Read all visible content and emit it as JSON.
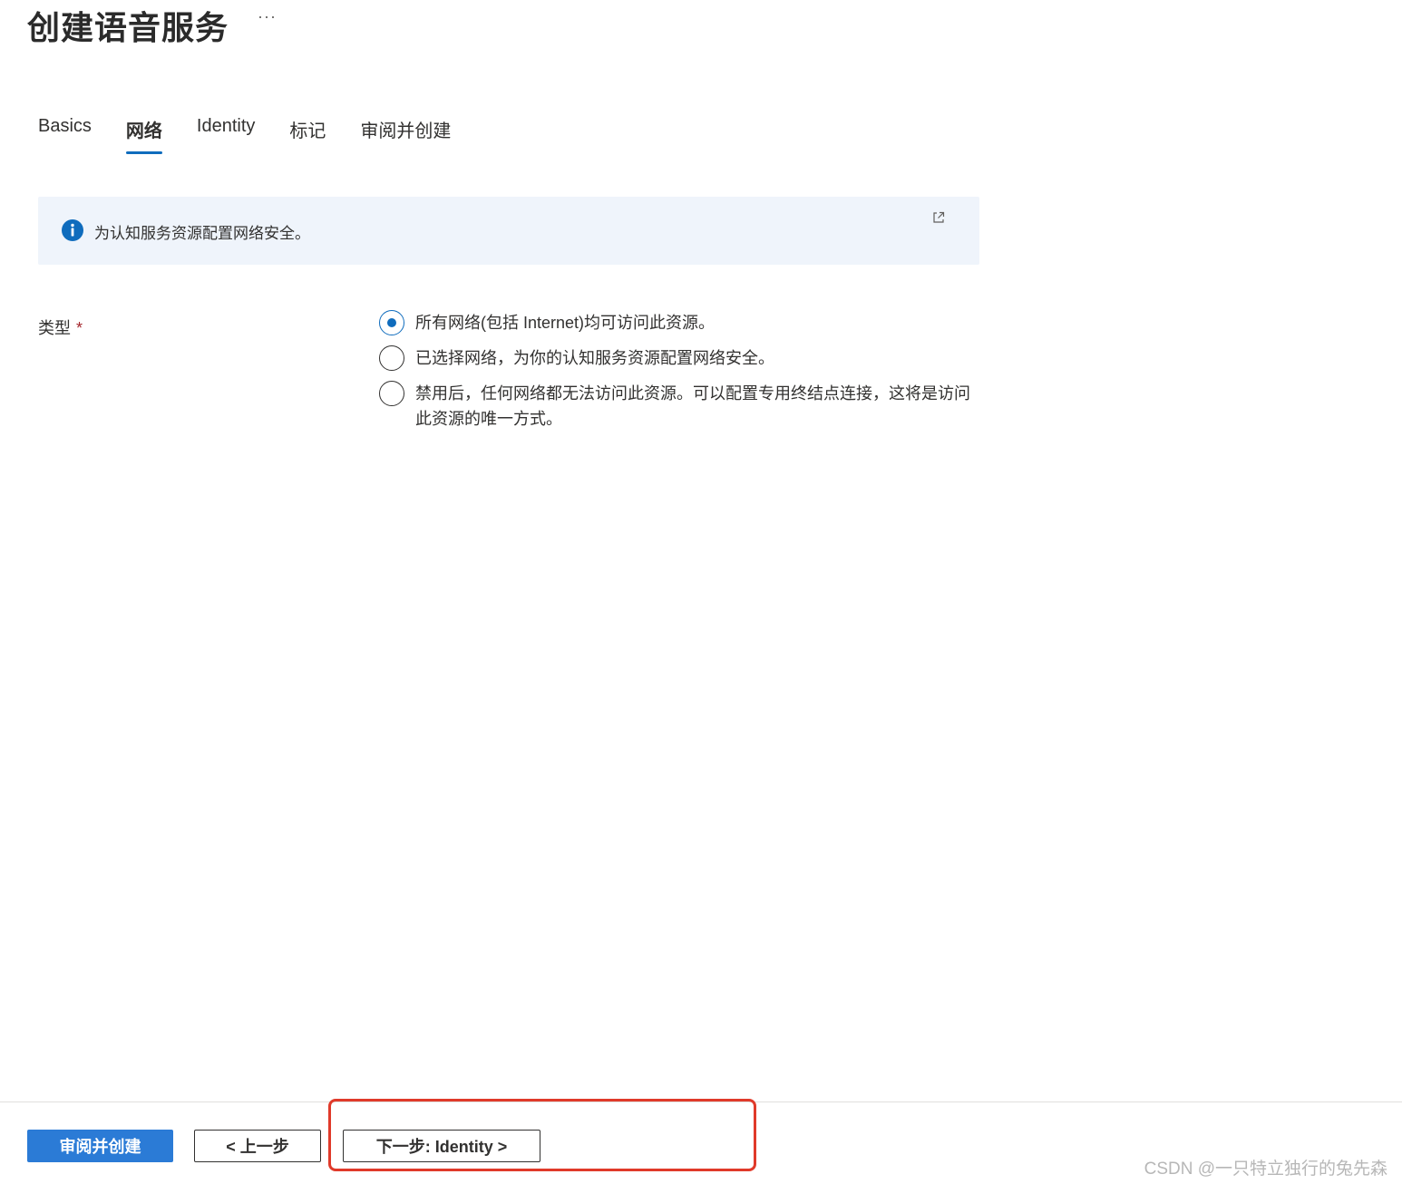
{
  "header": {
    "title": "创建语音服务",
    "more": "···"
  },
  "tabs": [
    {
      "label": "Basics",
      "active": false
    },
    {
      "label": "网络",
      "active": true
    },
    {
      "label": "Identity",
      "active": false
    },
    {
      "label": "标记",
      "active": false
    },
    {
      "label": "审阅并创建",
      "active": false
    }
  ],
  "info": {
    "text": "为认知服务资源配置网络安全。",
    "icon": "info-icon",
    "link_icon": "external-link-icon"
  },
  "form": {
    "type_label": "类型",
    "required_mark": "*",
    "options": [
      {
        "label": "所有网络(包括 Internet)均可访问此资源。",
        "checked": true
      },
      {
        "label": "已选择网络，为你的认知服务资源配置网络安全。",
        "checked": false
      },
      {
        "label": "禁用后，任何网络都无法访问此资源。可以配置专用终结点连接，这将是访问此资源的唯一方式。",
        "checked": false
      }
    ]
  },
  "footer": {
    "review_create": "审阅并创建",
    "prev": "< 上一步",
    "next": "下一步: Identity >"
  },
  "watermark": "CSDN @一只特立独行的兔先森",
  "colors": {
    "accent": "#0f6cbd",
    "primary_button": "#2b7bd6",
    "info_bg": "#eff4fb",
    "highlight": "#e03a2a"
  }
}
